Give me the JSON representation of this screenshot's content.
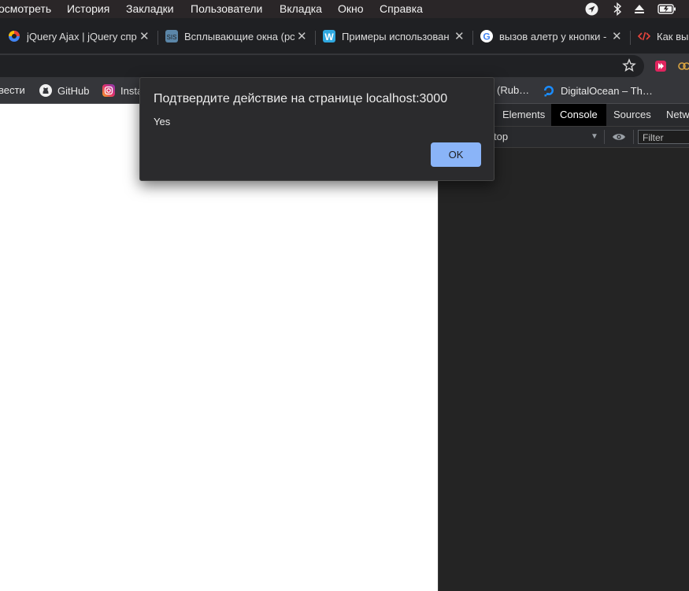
{
  "menubar": {
    "items": [
      "осмотреть",
      "История",
      "Закладки",
      "Пользователи",
      "Вкладка",
      "Окно",
      "Справка"
    ]
  },
  "tabs": [
    {
      "title": "jQuery Ajax | jQuery спр",
      "favicon": "jquery-icon"
    },
    {
      "title": "Всплывающие окна (рс",
      "favicon": "sis-icon"
    },
    {
      "title": "Примеры использован",
      "favicon": "w-icon"
    },
    {
      "title": "вызов алетр у кнопки -",
      "favicon": "google-icon"
    },
    {
      "title": "Как вы",
      "favicon": "code-icon"
    }
  ],
  "bookmarks": [
    {
      "label": "вести",
      "icon": ""
    },
    {
      "label": "GitHub",
      "icon": "github-icon"
    },
    {
      "label": "Insta",
      "icon": "instagram-icon"
    },
    {
      "label": "(Rub…",
      "icon": ""
    },
    {
      "label": "DigitalOcean – Th…",
      "icon": "digitalocean-icon"
    }
  ],
  "devtools": {
    "tabs": [
      "Elements",
      "Console",
      "Sources",
      "Netw"
    ],
    "active_tab": "Console",
    "context": "top",
    "filter_placeholder": "Filter"
  },
  "dialog": {
    "title": "Подтвердите действие на странице localhost:3000",
    "message": "Yes",
    "ok_label": "OK"
  },
  "colors": {
    "accent": "#8ab4f8",
    "menubar_bg": "#2a2628",
    "tabstrip_bg": "#1f2023",
    "toolbar_bg": "#35363a",
    "devtools_bg": "#242424"
  }
}
